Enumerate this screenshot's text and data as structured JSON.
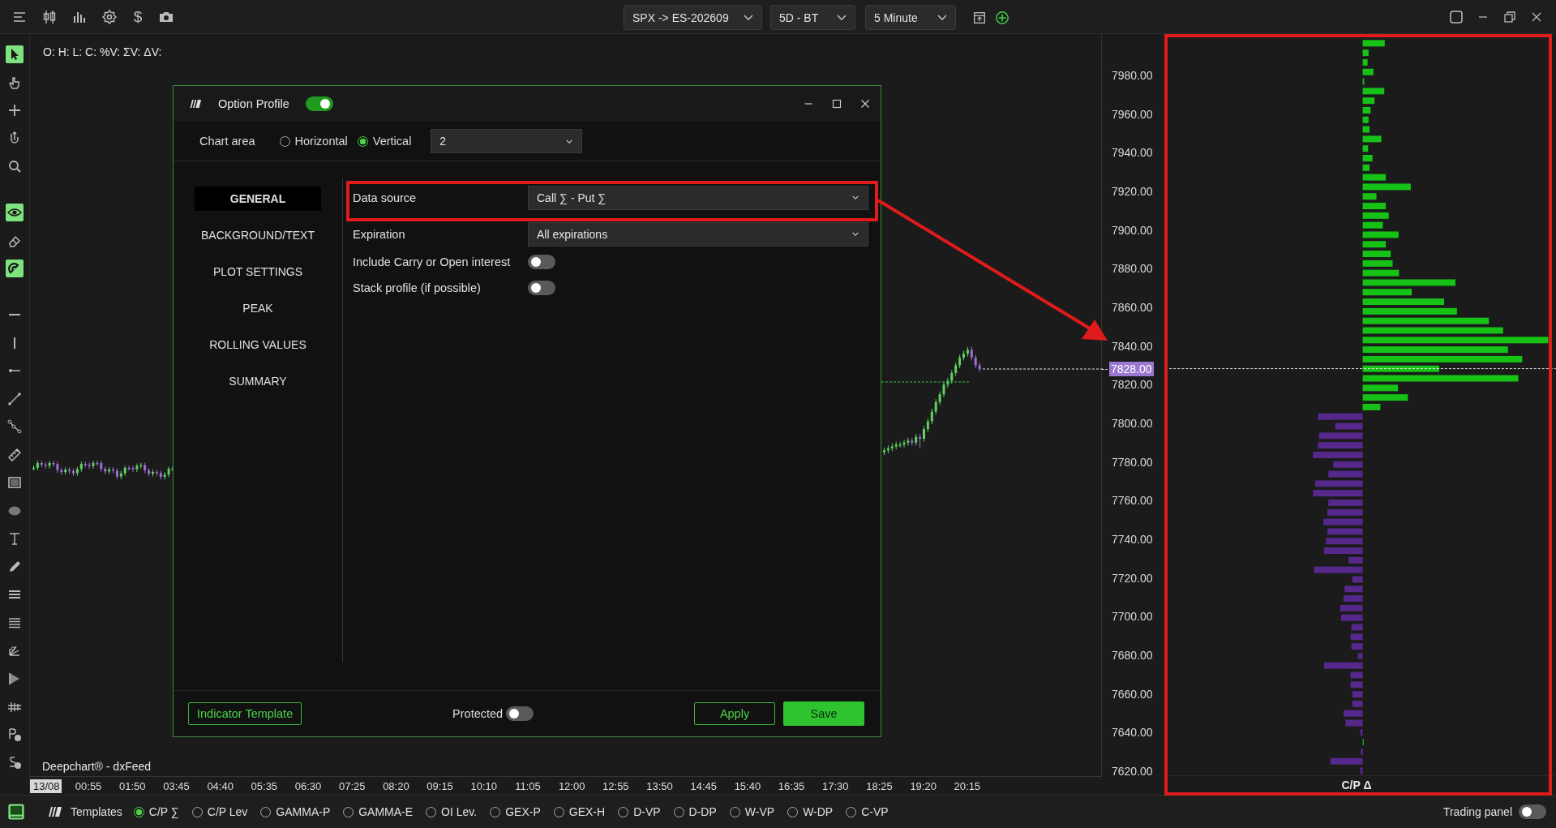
{
  "top_bar": {
    "currency_symbol": "$",
    "symbol_select": "SPX -> ES-202609",
    "range_select": "5D - BT",
    "interval_select": "5 Minute"
  },
  "tools": [
    {
      "on": true
    },
    {
      "on": false
    },
    {
      "on": false
    },
    {
      "on": false
    },
    {
      "on": false
    },
    {
      "on": true
    },
    {
      "on": false
    },
    {
      "on": true
    },
    {
      "on": false
    },
    {
      "on": false
    },
    {
      "on": false
    },
    {
      "on": false
    },
    {
      "on": false
    },
    {
      "on": false
    },
    {
      "on": false
    },
    {
      "on": false
    },
    {
      "on": false
    },
    {
      "on": false
    },
    {
      "on": false
    },
    {
      "on": false
    },
    {
      "on": false
    },
    {
      "on": false
    },
    {
      "on": false
    },
    {
      "on": false
    },
    {
      "on": false
    }
  ],
  "chart": {
    "ohlc_label": "O: H: L: C: %V: ΣV: ΔV:",
    "source_label": "Deepchart® - dxFeed",
    "current_price": "7828.00",
    "price_ticks": [
      "7980.00",
      "7960.00",
      "7940.00",
      "7920.00",
      "7900.00",
      "7880.00",
      "7860.00",
      "7840.00",
      "7820.00",
      "7800.00",
      "7780.00",
      "7760.00",
      "7740.00",
      "7720.00",
      "7700.00",
      "7680.00",
      "7660.00",
      "7640.00",
      "7620.00"
    ],
    "date_label": "13/08",
    "time_labels": [
      "00:55",
      "01:50",
      "03:45",
      "04:40",
      "05:35",
      "06:30",
      "07:25",
      "08:20",
      "09:15",
      "10:10",
      "11:05",
      "12:00",
      "12:55",
      "13:50",
      "14:45",
      "15:40",
      "16:35",
      "17:30",
      "18:25",
      "19:20",
      "20:15"
    ]
  },
  "profile": {
    "label": "C/P Δ"
  },
  "dialog": {
    "title": "Option Profile",
    "enabled": true,
    "chart_area_label": "Chart area",
    "orientations": [
      {
        "label": "Horizontal",
        "selected": false
      },
      {
        "label": "Vertical",
        "selected": true
      }
    ],
    "area_select": "2",
    "nav": [
      {
        "label": "GENERAL",
        "selected": true
      },
      {
        "label": "BACKGROUND/TEXT",
        "selected": false
      },
      {
        "label": "PLOT SETTINGS",
        "selected": false
      },
      {
        "label": "PEAK",
        "selected": false
      },
      {
        "label": "ROLLING VALUES",
        "selected": false
      },
      {
        "label": "SUMMARY",
        "selected": false
      }
    ],
    "fields": [
      {
        "kind": "select",
        "label": "Data source",
        "value": "Call ∑ - Put ∑"
      },
      {
        "kind": "select",
        "label": "Expiration",
        "value": "All expirations"
      },
      {
        "kind": "toggle",
        "label": "Include Carry or Open interest",
        "on": false
      },
      {
        "kind": "toggle",
        "label": "Stack profile (if possible)",
        "on": false
      }
    ],
    "template_button": "Indicator Template",
    "protected": {
      "label": "Protected",
      "on": false
    },
    "apply_button": "Apply",
    "save_button": "Save"
  },
  "bottom_bar": {
    "templates_label": "Templates",
    "templates": [
      {
        "label": "C/P ∑",
        "selected": true
      },
      {
        "label": "C/P Lev",
        "selected": false
      },
      {
        "label": "GAMMA-P",
        "selected": false
      },
      {
        "label": "GAMMA-E",
        "selected": false
      },
      {
        "label": "OI Lev.",
        "selected": false
      },
      {
        "label": "GEX-P",
        "selected": false
      },
      {
        "label": "GEX-H",
        "selected": false
      },
      {
        "label": "D-VP",
        "selected": false
      },
      {
        "label": "D-DP",
        "selected": false
      },
      {
        "label": "W-VP",
        "selected": false
      },
      {
        "label": "W-DP",
        "selected": false
      },
      {
        "label": "C-VP",
        "selected": false
      }
    ],
    "trading_panel": {
      "label": "Trading panel",
      "on": false
    }
  }
}
